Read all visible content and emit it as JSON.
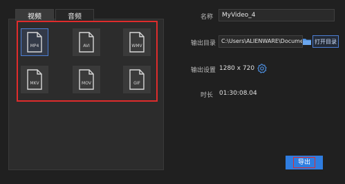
{
  "tabs": [
    {
      "label": "视频",
      "active": true
    },
    {
      "label": "音频",
      "active": false
    }
  ],
  "formats": [
    {
      "label": "MP4",
      "selected": true
    },
    {
      "label": "AVI",
      "selected": false
    },
    {
      "label": "WMV",
      "selected": false
    },
    {
      "label": "MKV",
      "selected": false
    },
    {
      "label": "MOV",
      "selected": false
    },
    {
      "label": "GIF",
      "selected": false
    }
  ],
  "settings": {
    "name_label": "名称",
    "name_value": "MyVideo_4",
    "dir_label": "输出目录",
    "dir_value": "C:\\Users\\ALIENWARE\\Documents",
    "open_dir_label": "打开目录",
    "output_label": "输出设置",
    "output_value": "1280 x 720",
    "duration_label": "时长",
    "duration_value": "01:30:08.04"
  },
  "export_label": "导出",
  "colors": {
    "accent": "#2f7de0",
    "highlight": "#e02c2c",
    "selected_border": "#4d7fd6"
  },
  "icons": [
    "file-icon",
    "folder-icon",
    "gear-icon"
  ]
}
